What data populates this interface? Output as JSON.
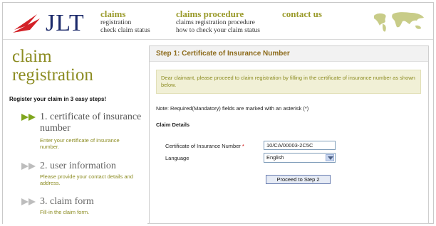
{
  "brand": {
    "logo_text": "JLT",
    "accent": "#d32127",
    "logo_color": "#1d2b6b"
  },
  "nav": {
    "claims": {
      "title": "claims",
      "links": [
        "registration",
        "check claim status"
      ]
    },
    "procedure": {
      "title": "claims procedure",
      "links": [
        "claims registration procedure",
        "how to check your claim status"
      ]
    },
    "contact": {
      "title": "contact us"
    }
  },
  "sidebar": {
    "title_line1": "claim",
    "title_line2": "registration",
    "intro": "Register your claim in 3 easy steps!",
    "steps": [
      {
        "title_line1": "1. certificate of insurance",
        "title_line2": "number",
        "desc_line1": "Enter your certificate of insurance",
        "desc_line2": "number.",
        "active": true
      },
      {
        "title_line1": "2. user information",
        "desc_line1": "Please provide your contact details and",
        "desc_line2": "address.",
        "active": false
      },
      {
        "title_line1": "3. claim form",
        "desc_line1": "Fill-in the claim form.",
        "active": false
      }
    ]
  },
  "main": {
    "heading": "Step 1: Certificate of Insurance Number",
    "notice": "Dear claimant, please proceed to claim registration by filling in the certificate of insurance number as shown below.",
    "required_note": "Note: Required(Mandatory) fields are marked with an asterisk (*)",
    "section_title": "Claim Details",
    "cert_label": "Certificate of Insurance Number",
    "cert_asterisk": "*",
    "cert_value": "10/CA/00003-2C5C",
    "language_label": "Language",
    "language_value": "English",
    "proceed_label": "Proceed to Step 2"
  },
  "colors": {
    "olive": "#8c8c22",
    "heading_brown": "#8c6a1a",
    "notice_bg": "#f1f0d6"
  }
}
